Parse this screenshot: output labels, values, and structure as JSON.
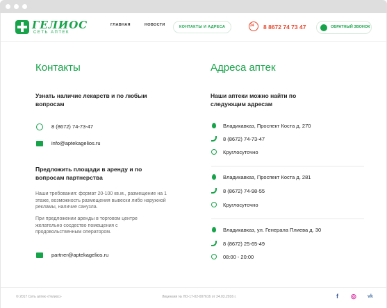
{
  "header": {
    "logo_name": "ГЕЛИОС",
    "logo_sub": "СЕТЬ АПТЕК",
    "nav": [
      "ГЛАВНАЯ",
      "НОВОСТИ",
      "КОНТАКТЫ И АДРЕСА"
    ],
    "phone": "8 8672 74 73 47",
    "phone_badge": "24",
    "callback": "ОБРАТНЫЙ ЗВОНОК"
  },
  "contacts": {
    "title": "Контакты",
    "inquiry_heading": "Узнать наличие лекарств и по любым вопросам",
    "phone": "8 (8672) 74-73-47",
    "email": "info@aptekagelios.ru",
    "rent_heading": "Предложить площади в аренду и по вопросам партнерства",
    "req_text": "Наши требования: формат 20-100 кв.м., размещение на 1 этаже, возможность размещения вывески либо наружной рекламы, наличие санузла.",
    "offer_text": "При предложении аренды в торговом центре желательно сосдество помещения с продовольственным оператором.",
    "partner_email": "partner@aptekagelios.ru"
  },
  "addresses": {
    "title": "Адреса аптек",
    "heading": "Наши аптеки можно найти по следующим адресам",
    "stores": [
      {
        "address": "Владикавказ, Проспект Коста д. 270",
        "phone": "8 (8672) 74-73-47",
        "hours": "Круглосуточно"
      },
      {
        "address": "Владикавказ, Проспект Коста д. 281",
        "phone": "8 (8672) 74-98-55",
        "hours": "Круглосуточно"
      },
      {
        "address": "Владикавказ, ул. Генерала Плиева д. 30",
        "phone": "8 (8672) 25-65-49",
        "hours": "08:00 - 20:00"
      }
    ]
  },
  "footer": {
    "copyright": "© 2017 Сеть аптек «Гелиос»",
    "license": "Лицензия № ЛО-17-02-007616 от 24.03.2016 г.",
    "social": {
      "facebook": "f",
      "instagram": "◎",
      "vk": "vk"
    }
  },
  "colors": {
    "accent": "#17a34a",
    "phone": "#e8462b",
    "instagram": "#d6249f",
    "vk": "#4a76a8",
    "facebook": "#3b5998"
  }
}
